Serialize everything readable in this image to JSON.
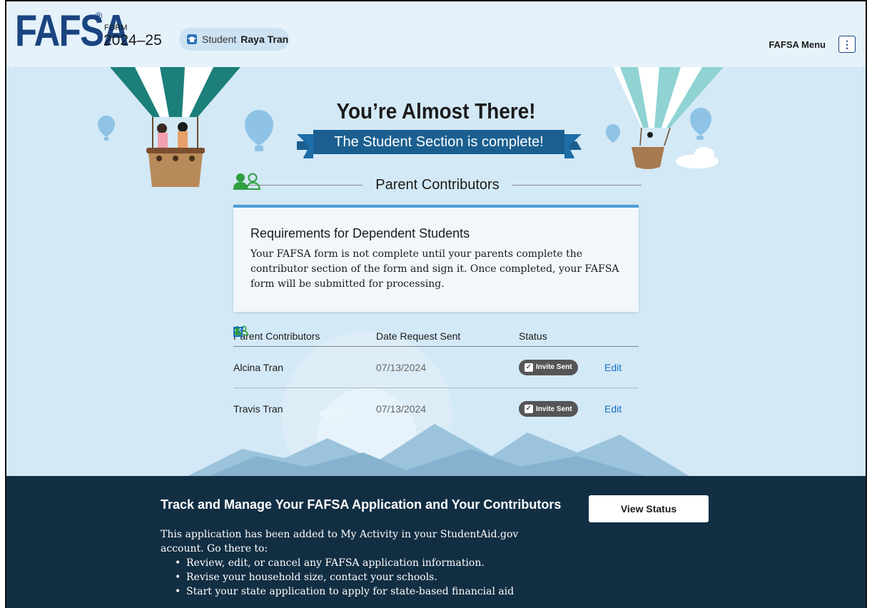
{
  "header": {
    "logo": "FAFSA",
    "registered": "®",
    "form_label": "FORM",
    "form_year": "2024–25",
    "chip_role": "Student",
    "chip_name": "Raya Tran",
    "menu_label": "FAFSA Menu",
    "menu_icon": "⋮"
  },
  "hero": {
    "title": "You’re Almost There!",
    "ribbon": "The Student Section is complete!"
  },
  "section": {
    "heading": "Parent Contributors"
  },
  "card": {
    "title": "Requirements for Dependent Students",
    "body": "Your FAFSA form is not complete until your parents complete the contributor section of the form and sign it. Once completed, your FAFSA form will be submitted for processing."
  },
  "table": {
    "headers": [
      "Parent Contributors",
      "Date Request Sent",
      "Status"
    ],
    "rows": [
      {
        "name": "Alcina Tran",
        "date": "07/13/2024",
        "status": "Invite Sent",
        "action": "Edit"
      },
      {
        "name": "Travis Tran",
        "date": "07/13/2024",
        "status": "Invite Sent",
        "action": "Edit"
      }
    ]
  },
  "footer": {
    "title": "Track and Manage Your FAFSA Application and Your Contributors",
    "button": "View Status",
    "lead": "This application has been added to My Activity in your StudentAid.gov account. Go there to:",
    "bullets": [
      "Review, edit, or cancel any FAFSA application information.",
      "Revise your household size, contact your schools.",
      "Start your state application to apply for state-based financial aid"
    ]
  },
  "colors": {
    "brand_blue": "#1a4480",
    "sky": "#d4e9f6",
    "ribbon": "#1a5f8f",
    "accent_green": "#2e9e3e",
    "footer_bg": "#122e42"
  }
}
